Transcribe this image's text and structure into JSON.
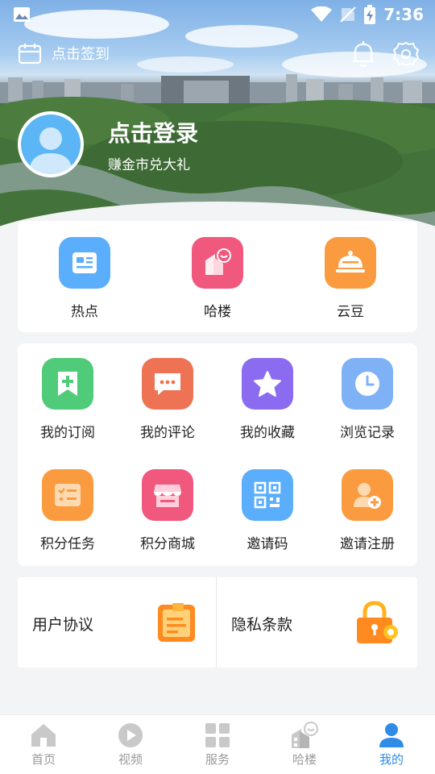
{
  "statusbar": {
    "time": "7:36"
  },
  "header": {
    "checkin_label": "点击签到"
  },
  "profile": {
    "title": "点击登录",
    "subtitle": "赚金市兑大礼"
  },
  "quick": [
    {
      "label": "热点",
      "icon": "news-icon",
      "color": "#5aaefb"
    },
    {
      "label": "哈楼",
      "icon": "building-icon",
      "color": "#f0587e"
    },
    {
      "label": "云豆",
      "icon": "dish-icon",
      "color": "#fb9b3f"
    }
  ],
  "features": [
    {
      "label": "我的订阅",
      "icon": "bookmark-plus-icon",
      "color": "#4fcb79"
    },
    {
      "label": "我的评论",
      "icon": "comment-icon",
      "color": "#ee7254"
    },
    {
      "label": "我的收藏",
      "icon": "star-icon",
      "color": "#8b6cf0"
    },
    {
      "label": "浏览记录",
      "icon": "clock-icon",
      "color": "#7fb1f7"
    },
    {
      "label": "积分任务",
      "icon": "task-list-icon",
      "color": "#fb9b3f"
    },
    {
      "label": "积分商城",
      "icon": "store-icon",
      "color": "#f0587e"
    },
    {
      "label": "邀请码",
      "icon": "qr-code-icon",
      "color": "#5aaefb"
    },
    {
      "label": "邀请注册",
      "icon": "add-user-icon",
      "color": "#fb9b3f"
    }
  ],
  "agreements": {
    "user_agreement": "用户协议",
    "privacy_policy": "隐私条款"
  },
  "tabs": [
    {
      "label": "首页",
      "icon": "home-icon"
    },
    {
      "label": "视频",
      "icon": "play-icon"
    },
    {
      "label": "服务",
      "icon": "grid-icon"
    },
    {
      "label": "哈楼",
      "icon": "building-icon"
    },
    {
      "label": "我的",
      "icon": "user-icon",
      "active": true
    }
  ],
  "colors": {
    "accent": "#2e8be6",
    "inactive_tab": "#9a9a9a"
  }
}
